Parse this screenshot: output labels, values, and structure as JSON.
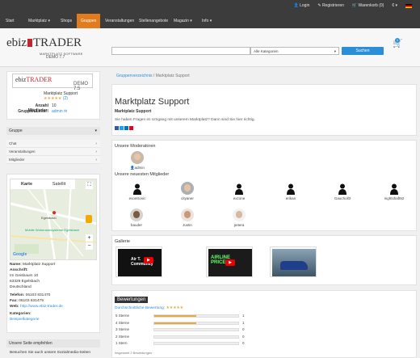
{
  "top": {
    "login": "Login",
    "register": "Registrieren",
    "cart": "Warenkorb (0)",
    "currency": "€"
  },
  "nav": [
    {
      "label": "Start"
    },
    {
      "label": "Marktplatz"
    },
    {
      "label": "Shops"
    },
    {
      "label": "Gruppen",
      "active": true
    },
    {
      "label": "Veranstaltungen"
    },
    {
      "label": "Stellenangebote"
    },
    {
      "label": "Magazin"
    },
    {
      "label": "Info"
    }
  ],
  "header": {
    "logo_left": "ebiz",
    "logo_right": "TRADER",
    "logo_sub": "MARKTPLATZ SOFTWARE",
    "version": "DEMO 7.7",
    "search_placeholder": "",
    "category": "Alle Kategorien",
    "search_button": "Suchen",
    "cart_count": "0"
  },
  "profile": {
    "name": "Marktplatz Support",
    "members_label": "Anzahl Mitglieder:",
    "members": "10",
    "leader_label": "Gruppen-Leiter:",
    "leader": "admin",
    "rating": "(2)",
    "version": "DEMO 7.5"
  },
  "sidebar": {
    "heading": "Gruppe",
    "items": [
      {
        "label": "Chat"
      },
      {
        "label": "Veranstaltungen"
      },
      {
        "label": "Mitglieder"
      }
    ],
    "map_tab1": "Karte",
    "map_tab2": "Satellit",
    "map_place": "Mobile Wohnraumsysteme Egelsbach",
    "map_city": "Egelsbach",
    "contact": {
      "name_label": "Name:",
      "name": "Marktplatz Support",
      "address_label": "Anschrift:",
      "street": "Im Geisbaum 10",
      "zip": "63329 Egelsbach",
      "country": "Deutschland",
      "phone_label": "Telefon:",
      "phone": "06103 831470",
      "fax_label": "Fax:",
      "fax": "06103 831479",
      "web_label": "Web:",
      "web": "http://www.ebiz-trader.de"
    },
    "categories_label": "Kategorien:",
    "category": "Beispielkategorie",
    "recommend_heading": "Unsere Seite empfehlen",
    "recommend_text": "Besuchen Sie auch unsere Sozialmedia-Seiten"
  },
  "breadcrumb": {
    "link": "Gruppenverzeichnis",
    "sep": "/",
    "current": "Marktplatz Support"
  },
  "group": {
    "title": "Marktplatz Support",
    "subtitle": "Marktplatz Support",
    "desc": "Sie haben Fragen im Umgang mit unserem Marktplatz? Dann sind Sie hier richtig."
  },
  "moderators": {
    "heading": "Unsere Moderatoren",
    "names": [
      "admin"
    ]
  },
  "members": {
    "heading": "Unsere neuesten Mitglieder",
    "row1": [
      "evontronic",
      "cityaner",
      "exzone",
      "erikan",
      "Gaucholl3",
      "nightshaft92"
    ],
    "row2": [
      "bauder",
      "Justin",
      "petera"
    ]
  },
  "gallery": {
    "heading": "Gallerie",
    "items": [
      "Air T. Community",
      "AIRLINE PRICE",
      "car photo"
    ]
  },
  "ratings": {
    "heading": "Bewertungen",
    "avg_label": "Durchschnittliche Bewertung:",
    "rows": [
      {
        "label": "5 Sterne",
        "value": 1,
        "count": "1"
      },
      {
        "label": "4 Sterne",
        "value": 1,
        "count": "1"
      },
      {
        "label": "3 Sterne",
        "value": 0,
        "count": "0"
      },
      {
        "label": "2 Sterne",
        "value": 0,
        "count": "0"
      },
      {
        "label": "1 Stern",
        "value": 0,
        "count": "0"
      }
    ],
    "footer": "insgesamt 2 Bewertungen"
  }
}
